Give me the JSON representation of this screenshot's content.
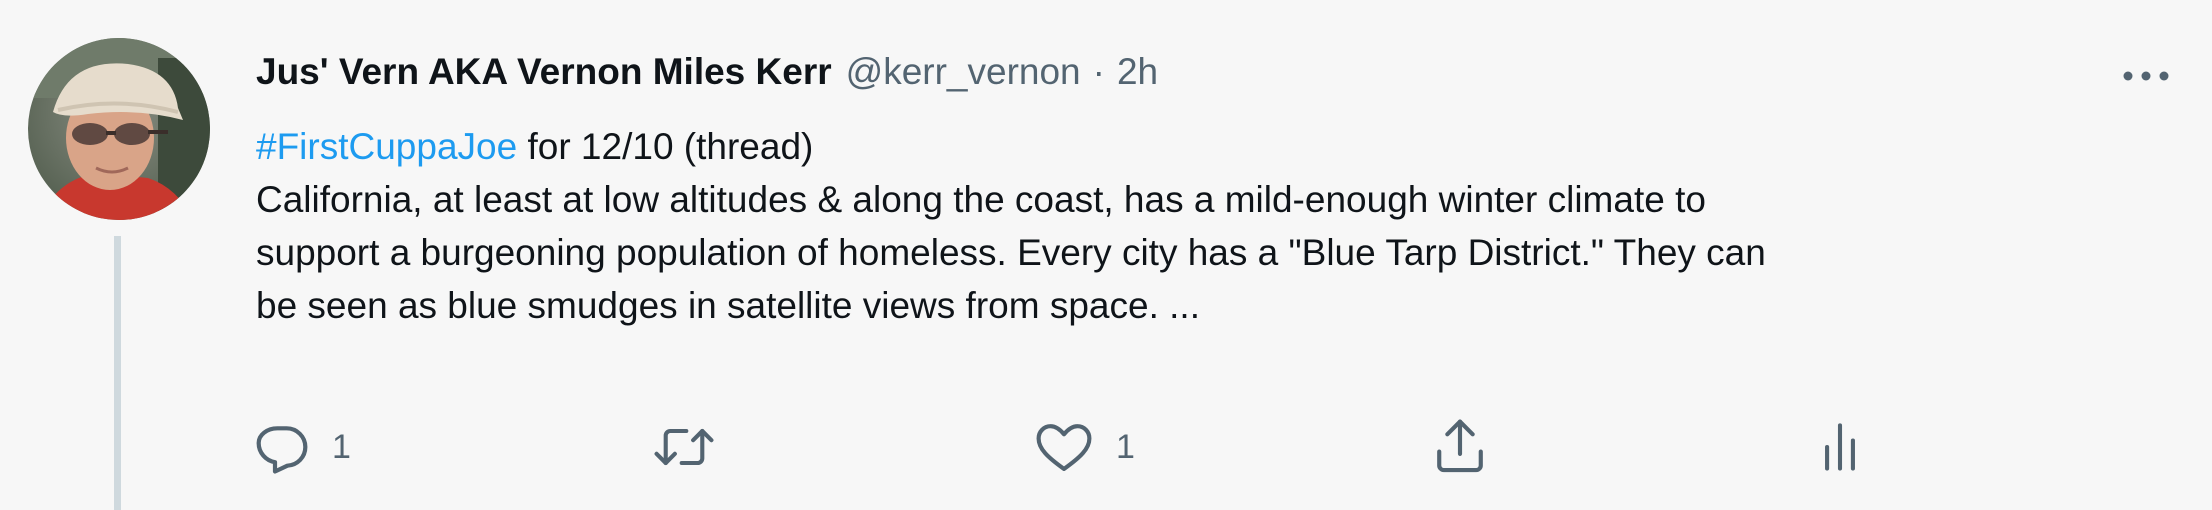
{
  "tweet": {
    "author": {
      "display_name": "Jus' Vern AKA Vernon Miles Kerr",
      "handle": "@kerr_vernon"
    },
    "separator": "·",
    "time": "2h",
    "hashtag": "#FirstCuppaJoe",
    "first_line_rest": " for 12/10 (thread)",
    "body_lines": [
      "California, at least at low altitudes & along the coast, has a mild-enough winter climate to",
      "support a burgeoning population of homeless.  Every city has a \"Blue Tarp District.\" They can",
      "be seen as blue smudges in satellite views from space. ..."
    ]
  },
  "actions": {
    "reply": {
      "icon": "reply-icon",
      "count": "1"
    },
    "retweet": {
      "icon": "retweet-icon",
      "count": ""
    },
    "like": {
      "icon": "heart-icon",
      "count": "1"
    },
    "share": {
      "icon": "share-icon",
      "count": ""
    },
    "analytics": {
      "icon": "analytics-icon",
      "count": ""
    }
  },
  "colors": {
    "background": "#f7f7f7",
    "text": "#0f1419",
    "secondary": "#536471",
    "link": "#1d9bf0",
    "thread_line": "#cfd9de"
  }
}
